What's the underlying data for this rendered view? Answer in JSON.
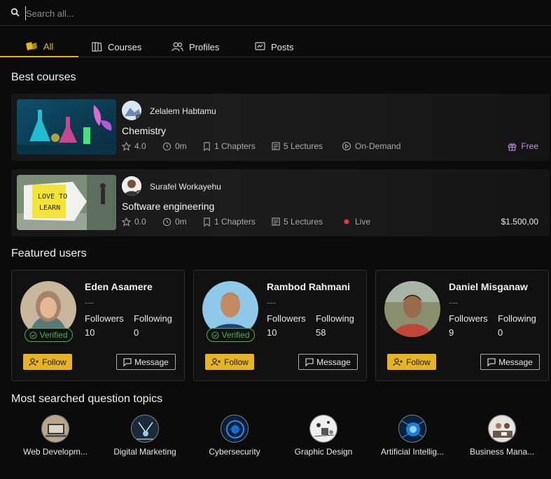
{
  "search": {
    "placeholder": "Search all..."
  },
  "tabs": [
    {
      "label": "All",
      "icon": "all-icon",
      "active": true
    },
    {
      "label": "Courses",
      "icon": "book-icon"
    },
    {
      "label": "Profiles",
      "icon": "users-icon"
    },
    {
      "label": "Posts",
      "icon": "post-icon"
    }
  ],
  "sections": {
    "best_courses": "Best courses",
    "featured_users": "Featured users",
    "topics": "Most searched question topics"
  },
  "courses": [
    {
      "author": "Zelalem Habtamu",
      "title": "Chemistry",
      "rating": "4.0",
      "duration": "0m",
      "chapters": "1 Chapters",
      "lectures": "5 Lectures",
      "mode": "On-Demand",
      "price": "Free"
    },
    {
      "author": "Surafel Workayehu",
      "title": "Software engineering",
      "rating": "0.0",
      "duration": "0m",
      "chapters": "1 Chapters",
      "lectures": "5 Lectures",
      "mode": "Live",
      "price": "$1.500,00"
    }
  ],
  "users": [
    {
      "name": "Eden Asamere",
      "bio": "---",
      "followers_label": "Followers",
      "followers": "10",
      "following_label": "Following",
      "following": "0",
      "verified": "Verified",
      "follow": "Follow",
      "message": "Message"
    },
    {
      "name": "Rambod Rahmani",
      "bio": "---",
      "followers_label": "Followers",
      "followers": "10",
      "following_label": "Following",
      "following": "58",
      "verified": "Verified",
      "follow": "Follow",
      "message": "Message"
    },
    {
      "name": "Daniel Misganaw",
      "bio": "---",
      "followers_label": "Followers",
      "followers": "9",
      "following_label": "Following",
      "following": "0",
      "follow": "Follow",
      "message": "Message"
    }
  ],
  "topics": [
    {
      "label": "Web Developm..."
    },
    {
      "label": "Digital Marketing"
    },
    {
      "label": "Cybersecurity"
    },
    {
      "label": "Graphic Design"
    },
    {
      "label": "Artificial Intellig..."
    },
    {
      "label": "Business Mana..."
    }
  ],
  "colors": {
    "accent": "#e6b422",
    "verified": "#4caf50",
    "free": "#c792ea",
    "live": "#e53935"
  }
}
